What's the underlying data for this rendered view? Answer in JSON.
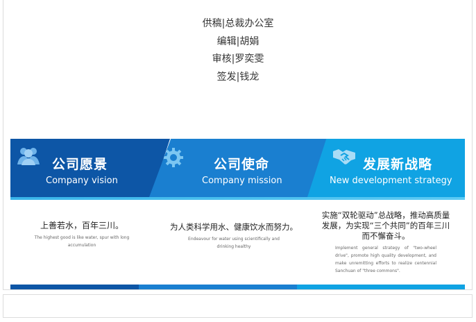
{
  "credits": [
    "供稿|总裁办公室",
    "编辑|胡娟",
    "审核|罗奕雯",
    "签发|钱龙"
  ],
  "banner": {
    "panels": [
      {
        "title": "公司愿景",
        "subtitle": "Company vision",
        "icon": "people-group-icon",
        "cn_text": "上善若水，百年三川。",
        "en_text": "The highest good is like water, spur with long accumulation"
      },
      {
        "title": "公司使命",
        "subtitle": "Company mission",
        "icon": "gear-icon",
        "cn_text": "为人类科学用水、健康饮水而努力。",
        "en_text": "Endeavour for water using scientifically and drinking healthy"
      },
      {
        "title": "发展新战略",
        "subtitle": "New development strategy",
        "icon": "handshake-icon",
        "cn_text": "实施“双轮驱动”总战略，推动高质量发展，为实现“三个共同”的百年三川而不懈奋斗。",
        "en_text": "Implement general strategy of \"two-wheel drive\", promote high quality development, and make unremitting efforts to realize centennial Sanchuan of \"three commons\"."
      }
    ],
    "colors": {
      "vision": "#0d56a6",
      "mission": "#1a7fd0",
      "strategy": "#10a3e3"
    }
  }
}
